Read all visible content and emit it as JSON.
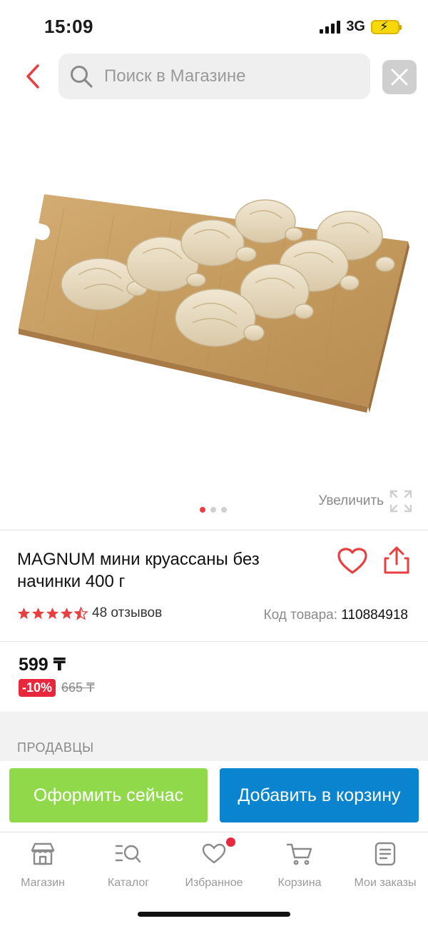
{
  "status_bar": {
    "time": "15:09",
    "network": "3G"
  },
  "search": {
    "placeholder": "Поиск в Магазине"
  },
  "gallery": {
    "zoom_label": "Увеличить",
    "image_count": 3,
    "active_image": 1
  },
  "product": {
    "title": "MAGNUM мини круассаны без начинки 400 г",
    "rating": 4.5,
    "reviews": "48 отзывов",
    "code_label": "Код товара:",
    "code_value": "110884918",
    "price": "599 ₸",
    "discount": "-10%",
    "old_price": "665 ₸"
  },
  "sellers": {
    "label": "ПРОДАВЦЫ"
  },
  "actions": {
    "checkout_label": "Оформить сейчас",
    "add_to_cart_label": "Добавить в корзину"
  },
  "bottom_nav": {
    "items": [
      {
        "label": "Магазин",
        "icon": "store-icon"
      },
      {
        "label": "Каталог",
        "icon": "catalog-icon"
      },
      {
        "label": "Избранное",
        "icon": "heart-icon",
        "badge": true
      },
      {
        "label": "Корзина",
        "icon": "cart-icon"
      },
      {
        "label": "Мои заказы",
        "icon": "orders-icon"
      }
    ]
  },
  "colors": {
    "accent_red": "#e84040",
    "checkout_green": "#8fd94a",
    "cart_blue": "#0a84ce",
    "discount_red": "#e8273c"
  }
}
